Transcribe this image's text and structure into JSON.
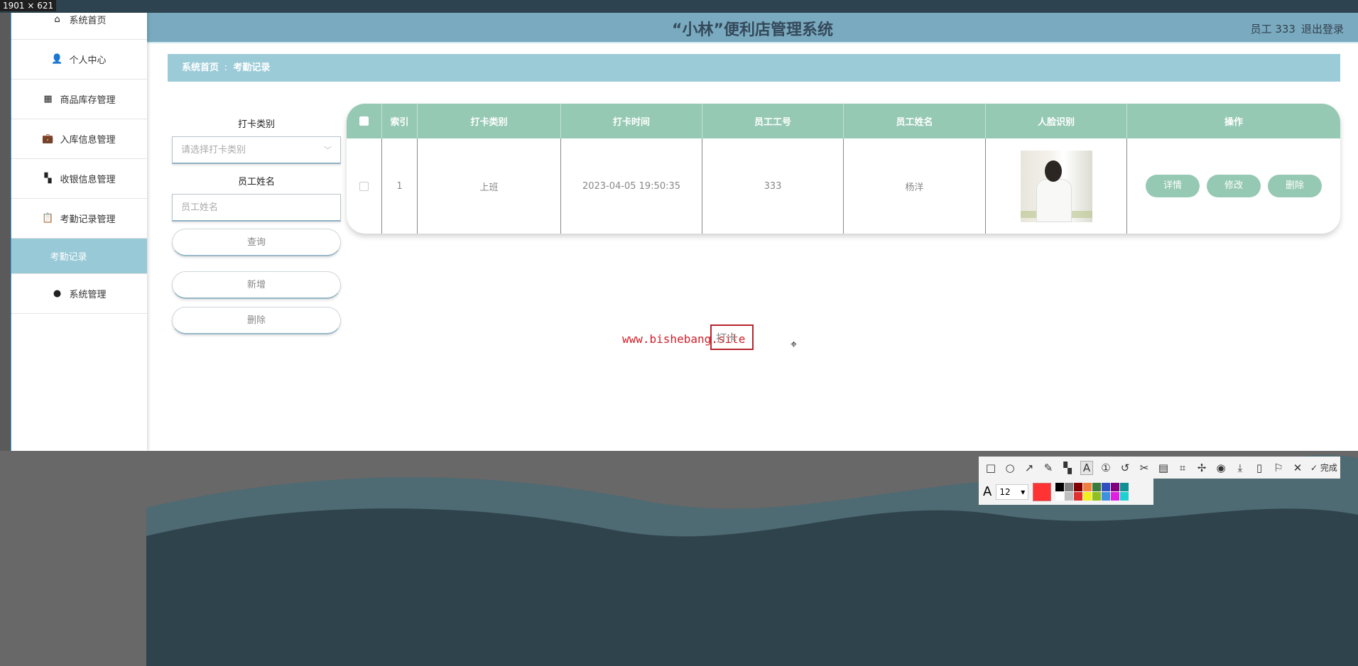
{
  "overlay": {
    "size_label": "1901 × 621",
    "watermark": "www.bishebang.site",
    "text_box": "打卡",
    "font_size": "12",
    "done_label": "完成",
    "current_color": "#ff3333",
    "palette": [
      "#000000",
      "#808080",
      "#800000",
      "#f08040",
      "#3a7a3a",
      "#3050c0",
      "#800080",
      "#109090",
      "#ffffff",
      "#c0c0c0",
      "#e03030",
      "#f0f020",
      "#90c020",
      "#4090e0",
      "#e020e0",
      "#20d0d0"
    ]
  },
  "header": {
    "title": "“小林”便利店管理系统",
    "user": "员工 333",
    "logout": "退出登录"
  },
  "sidebar": {
    "items": [
      {
        "label": "系统首页",
        "icon": "home-icon",
        "glyph": "⌂"
      },
      {
        "label": "个人中心",
        "icon": "user-icon",
        "glyph": "👤"
      },
      {
        "label": "商品库存管理",
        "icon": "grid-icon",
        "glyph": "▦"
      },
      {
        "label": "入库信息管理",
        "icon": "briefcase-icon",
        "glyph": "💼"
      },
      {
        "label": "收银信息管理",
        "icon": "dashboard-icon",
        "glyph": "▚"
      },
      {
        "label": "考勤记录管理",
        "icon": "clipboard-icon",
        "glyph": "📋"
      }
    ],
    "active": "考勤记录",
    "last": {
      "label": "系统管理",
      "icon": "lightbulb-icon",
      "glyph": "●"
    }
  },
  "breadcrumb": {
    "home": "系统首页",
    "sep": "ː",
    "current": "考勤记录"
  },
  "search": {
    "type_label": "打卡类别",
    "type_placeholder": "请选择打卡类别",
    "name_label": "员工姓名",
    "name_placeholder": "员工姓名",
    "query": "查询",
    "add": "新增",
    "delete": "删除"
  },
  "table": {
    "columns": [
      "索引",
      "打卡类别",
      "打卡时间",
      "员工工号",
      "员工姓名",
      "人脸识别",
      "操作"
    ],
    "rows": [
      {
        "index": "1",
        "type": "上班",
        "time": "2023-04-05 19:50:35",
        "emp_no": "333",
        "emp_name": "杨洋"
      }
    ],
    "actions": [
      "详情",
      "修改",
      "删除"
    ]
  }
}
